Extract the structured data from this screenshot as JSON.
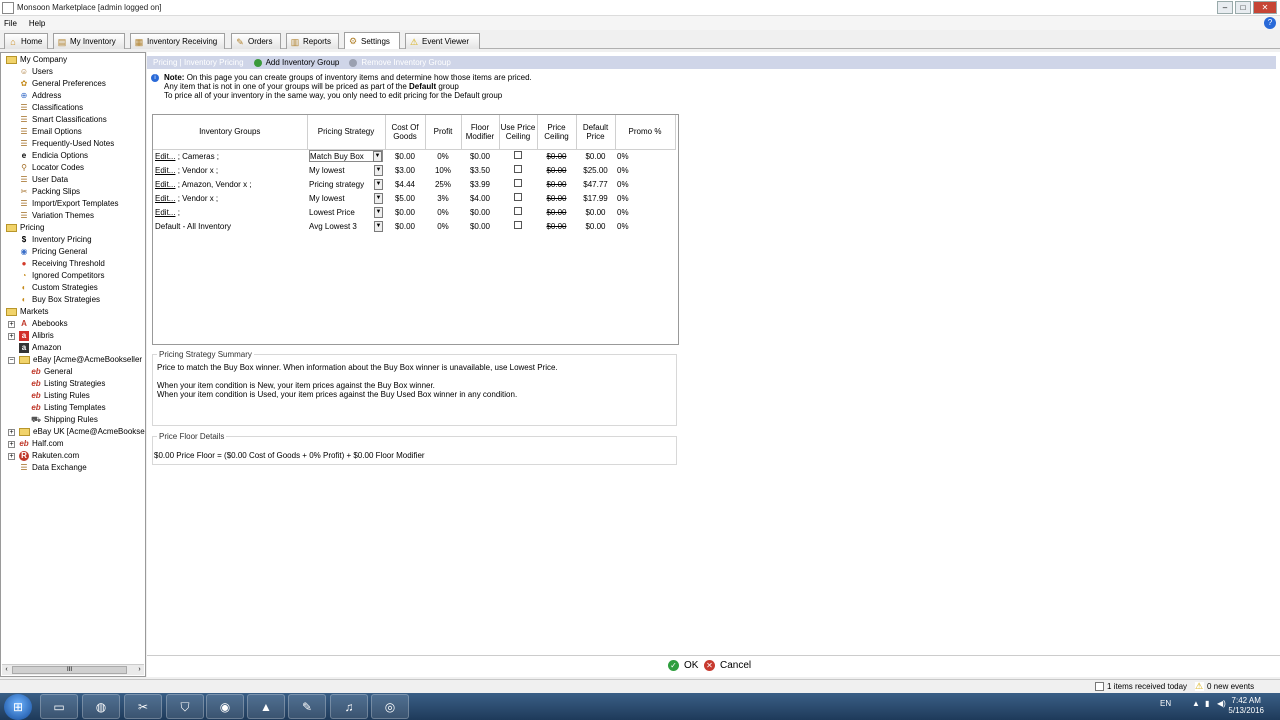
{
  "window": {
    "title": "Monsoon Marketplace [admin logged on]"
  },
  "menu": {
    "file": "File",
    "help": "Help"
  },
  "tabs": [
    {
      "label": "Home",
      "icon": "home-icon"
    },
    {
      "label": "My Inventory",
      "icon": "inventory-icon"
    },
    {
      "label": "Inventory Receiving",
      "icon": "receiving-icon"
    },
    {
      "label": "Orders",
      "icon": "orders-icon"
    },
    {
      "label": "Reports",
      "icon": "reports-icon"
    },
    {
      "label": "Settings",
      "icon": "settings-icon"
    },
    {
      "label": "Event Viewer",
      "icon": "warning-icon"
    }
  ],
  "active_tab": "Settings",
  "sidebar": {
    "my_company": "My Company",
    "company_items": [
      "Users",
      "General Preferences",
      "Address",
      "Classifications",
      "Smart Classifications",
      "Email Options",
      "Frequently-Used Notes",
      "Endicia Options",
      "Locator Codes",
      "User Data",
      "Packing Slips",
      "Import/Export Templates",
      "Variation Themes"
    ],
    "pricing": "Pricing",
    "pricing_items": [
      "Inventory Pricing",
      "Pricing General",
      "Receiving Threshold",
      "Ignored Competitors",
      "Custom Strategies",
      "Buy Box Strategies"
    ],
    "markets": "Markets",
    "market_items": [
      "Abebooks",
      "Alibris",
      "Amazon",
      "eBay [Acme@AcmeBookseller",
      "General",
      "Listing Strategies",
      "Listing Rules",
      "Listing Templates",
      "Shipping Rules",
      "eBay UK [Acme@AcmeBookse",
      "Half.com",
      "Rakuten.com",
      "Data Exchange"
    ],
    "scroll_thumb": "III"
  },
  "subbar": {
    "breadcrumb": "Pricing | Inventory Pricing",
    "add_group": "Add Inventory Group",
    "remove_group": "Remove Inventory Group"
  },
  "note": {
    "label": "Note:",
    "line1": "On this page you can create groups of inventory items and determine how those items are priced.",
    "line2a": "Any item that is not in one of your groups will be priced as part of the",
    "line2b": "Default",
    "line2c": "group",
    "line3": "To price all of your inventory in the same way, you only need to edit pricing for the Default group"
  },
  "grid": {
    "headers": [
      "Inventory Groups",
      "Pricing Strategy",
      "Cost Of Goods",
      "Profit",
      "Floor Modifier",
      "Use Price Ceiling",
      "Price Ceiling",
      "Default Price",
      "Promo %"
    ],
    "rows": [
      {
        "edit": "Edit...",
        "group": "; Cameras ;",
        "strategy": "Match Buy Box",
        "cost": "$0.00",
        "profit": "0%",
        "floor": "$0.00",
        "use_ceiling": false,
        "ceiling": "$0.00",
        "default_price": "$0.00",
        "promo": "0%"
      },
      {
        "edit": "Edit...",
        "group": "; Vendor x ;",
        "strategy": "My lowest",
        "cost": "$3.00",
        "profit": "10%",
        "floor": "$3.50",
        "use_ceiling": false,
        "ceiling": "$0.00",
        "default_price": "$25.00",
        "promo": "0%"
      },
      {
        "edit": "Edit...",
        "group": "; Amazon, Vendor x ;",
        "strategy": "Pricing strategy",
        "cost": "$4.44",
        "profit": "25%",
        "floor": "$3.99",
        "use_ceiling": false,
        "ceiling": "$0.00",
        "default_price": "$47.77",
        "promo": "0%"
      },
      {
        "edit": "Edit...",
        "group": "; Vendor x ;",
        "strategy": "My lowest",
        "cost": "$5.00",
        "profit": "3%",
        "floor": "$4.00",
        "use_ceiling": false,
        "ceiling": "$0.00",
        "default_price": "$17.99",
        "promo": "0%"
      },
      {
        "edit": "Edit...",
        "group": ";",
        "strategy": "Lowest Price",
        "cost": "$0.00",
        "profit": "0%",
        "floor": "$0.00",
        "use_ceiling": false,
        "ceiling": "$0.00",
        "default_price": "$0.00",
        "promo": "0%"
      },
      {
        "edit": "",
        "group": "Default - All Inventory",
        "strategy": "Avg Lowest 3",
        "cost": "$0.00",
        "profit": "0%",
        "floor": "$0.00",
        "use_ceiling": false,
        "ceiling": "$0.00",
        "default_price": "$0.00",
        "promo": "0%"
      }
    ]
  },
  "summary": {
    "title": "Pricing Strategy Summary",
    "line1": "Price to match the Buy Box winner. When information about the Buy Box winner is unavailable, use Lowest Price.",
    "line2": "When your item condition is New, your item prices against the Buy Box winner.",
    "line3": "When your item condition is Used, your item prices against the Buy Used Box winner in any condition."
  },
  "floor": {
    "title": "Price Floor Details",
    "formula": "$0.00 Price Floor  =  ($0.00 Cost of Goods  + 0% Profit)  + $0.00 Floor Modifier"
  },
  "buttons": {
    "ok": "OK",
    "cancel": "Cancel"
  },
  "status": {
    "received": "1 items received today",
    "events": "0 new events"
  },
  "taskbar": {
    "lang": "EN",
    "time": "7:42 AM",
    "date": "5/13/2016"
  },
  "colors": {
    "subbar_bg": "#cfd5e8",
    "ok_green": "#2e9e3e",
    "cancel_red": "#c73a2f",
    "taskbar": "#2b4d72"
  }
}
